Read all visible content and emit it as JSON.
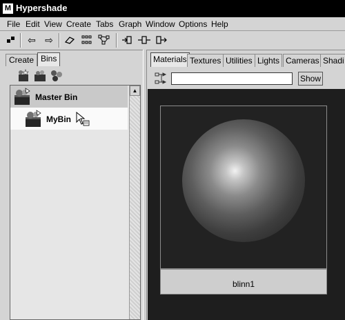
{
  "window": {
    "title": "Hypershade"
  },
  "menu": [
    "File",
    "Edit",
    "View",
    "Create",
    "Tabs",
    "Graph",
    "Window",
    "Options",
    "Help"
  ],
  "left_panel": {
    "tabs": [
      {
        "label": "Create",
        "active": false
      },
      {
        "label": "Bins",
        "active": true
      }
    ],
    "bins": [
      {
        "label": "Master Bin",
        "selected": true
      },
      {
        "label": "MyBin",
        "selected": false
      }
    ]
  },
  "right_panel": {
    "tabs": [
      {
        "label": "Materials",
        "active": true
      },
      {
        "label": "Textures"
      },
      {
        "label": "Utilities"
      },
      {
        "label": "Lights"
      },
      {
        "label": "Cameras"
      },
      {
        "label": "Shadi"
      }
    ],
    "filter": {
      "value": "",
      "show_label": "Show"
    },
    "swatch": {
      "name": "blinn1"
    }
  },
  "colors": {
    "titlebar": "#000000",
    "workarea": "#1e1e1e",
    "panel": "#d4d4d4"
  },
  "icons": [
    "maya-logo-icon",
    "select-icon",
    "arrow-left-icon",
    "arrow-right-icon",
    "eraser-icon",
    "grid-icon",
    "graph-icon",
    "input-connections-icon",
    "input-output-icon",
    "output-connections-icon",
    "new-bin-icon",
    "bin-icon",
    "bin-options-icon",
    "filter-icon",
    "cursor-icon"
  ]
}
